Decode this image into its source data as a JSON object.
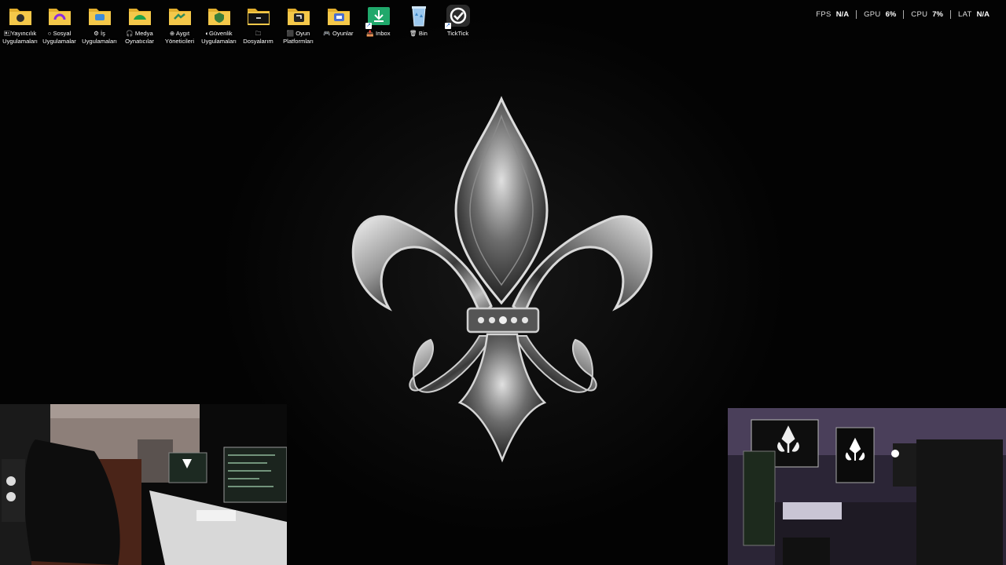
{
  "desktop": {
    "icons": [
      {
        "label_1": "🖭Yayıncılık",
        "label_2": "Uygulamaları",
        "icon": "folder-icon",
        "accent": "#2d2d2d"
      },
      {
        "label_1": "○ Sosyal",
        "label_2": "Uygulamalar",
        "icon": "folder-icon",
        "accent": "#8a2be2"
      },
      {
        "label_1": "⚙ İş",
        "label_2": "Uygulamaları",
        "icon": "folder-icon",
        "accent": "#3d8bd9"
      },
      {
        "label_1": "🎧 Medya",
        "label_2": "Oynatıcılar",
        "icon": "folder-icon",
        "accent": "#1fa24a"
      },
      {
        "label_1": "⊕ Aygıt",
        "label_2": "Yöneticileri",
        "icon": "folder-icon",
        "accent": "#2f8a5a"
      },
      {
        "label_1": "◐Güvenlik",
        "label_2": "Uygulamaları",
        "icon": "folder-icon",
        "accent": "#3a7d3a"
      },
      {
        "label_1": "🗀",
        "label_2": "Dosyalarım",
        "icon": "folder-icon",
        "accent": "#111111"
      },
      {
        "label_1": "⬛ Oyun",
        "label_2": "Platformları",
        "icon": "folder-icon",
        "accent": "#222222"
      },
      {
        "label_1": "🎮 Oyunlar",
        "label_2": "",
        "icon": "folder-icon",
        "accent": "#4a6fd1"
      },
      {
        "label_1": "📥 Inbox",
        "label_2": "",
        "icon": "download-icon",
        "accent": "#20a86b"
      },
      {
        "label_1": "🗑 Bin",
        "label_2": "",
        "icon": "recycle-bin-icon",
        "accent": "#7fb6e6"
      },
      {
        "label_1": "TickTick",
        "label_2": "",
        "icon": "ticktick-icon",
        "accent": "#2b2b2b"
      }
    ]
  },
  "perf": {
    "fps_label": "FPS",
    "fps_value": "N/A",
    "gpu_label": "GPU",
    "gpu_value": "6%",
    "cpu_label": "CPU",
    "cpu_value": "7%",
    "lat_label": "LAT",
    "lat_value": "N/A"
  },
  "colors": {
    "folder": "#f4c84a",
    "folder_dark": "#e2ae2d",
    "background": "#000000"
  }
}
